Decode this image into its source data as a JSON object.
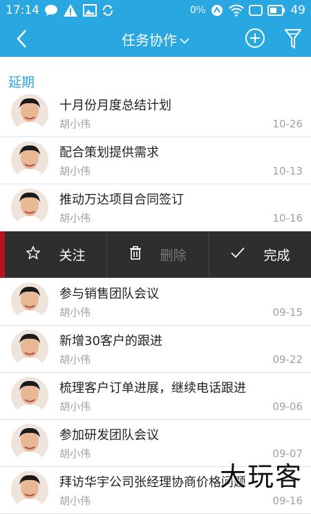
{
  "status_bar": {
    "time": "17:14",
    "signal_text": "0⁰⁄₀",
    "battery": "49",
    "icons": [
      "chat-icon",
      "warning-icon",
      "image-icon",
      "sync-icon",
      "nfc-icon",
      "wifi-icon",
      "screen-icon",
      "battery-icon"
    ]
  },
  "toolbar": {
    "title": "任务协作",
    "back_icon": "chevron-left-icon",
    "dropdown_icon": "chevron-down-icon",
    "add_icon": "plus-circle-icon",
    "filter_icon": "filter-icon"
  },
  "section": {
    "label": "延期"
  },
  "tasks_before": [
    {
      "title": "十月份月度总结计划",
      "owner": "胡小伟",
      "date": "10-26"
    },
    {
      "title": "配合策划提供需求",
      "owner": "胡小伟",
      "date": "10-13"
    },
    {
      "title": "推动万达项目合同签订",
      "owner": "胡小伟",
      "date": "10-16"
    }
  ],
  "swipe_actions": {
    "follow_label": "关注",
    "delete_label": "删除",
    "complete_label": "完成"
  },
  "tasks_after": [
    {
      "title": "参与销售团队会议",
      "owner": "胡小伟",
      "date": "09-15"
    },
    {
      "title": "新增30客户的跟进",
      "owner": "胡小伟",
      "date": "09-22"
    },
    {
      "title": "梳理客户订单进展，继续电话跟进",
      "owner": "胡小伟",
      "date": "09-06"
    },
    {
      "title": "参加研发团队会议",
      "owner": "胡小伟",
      "date": "09-07"
    },
    {
      "title": "拜访华宇公司张经理协商价格问题",
      "owner": "胡小伟",
      "date": "09-16"
    }
  ],
  "watermark": "大玩客",
  "colors": {
    "accent": "#29a7e1",
    "swipe_bg": "#2e2e2e",
    "swipe_accent": "#b8121d"
  }
}
